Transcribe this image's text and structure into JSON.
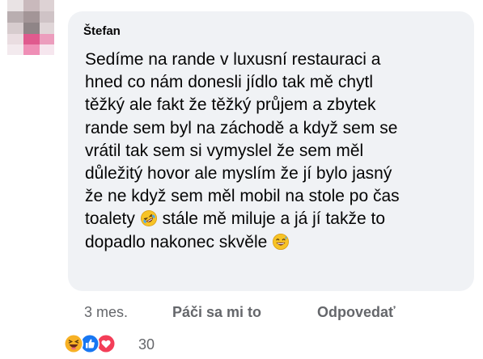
{
  "comment": {
    "author": "Štefan",
    "lines": [
      "Sedíme na rande v luxusní restauraci a",
      "hned co nám donesli jídlo tak mě chytl",
      "těžký ale fakt že těžký průjem a zbytek",
      "rande sem byl na záchodě a když sem se",
      "vrátil tak sem si vymyslel že sem měl",
      "důležitý hovor ale myslím že jí bylo jasný",
      "že ne když sem měl mobil na stole po čas"
    ],
    "line8_before": "toalety",
    "line8_after": "stále mě miluje a já jí takže to",
    "line9": "dopadlo nakonec skvěle",
    "emojis": [
      "rolling-on-floor-laughing-emoji",
      "grinning-sweat-emoji"
    ]
  },
  "meta": {
    "time": "3 mes.",
    "like_label": "Páči sa mi to",
    "reply_label": "Odpovedať"
  },
  "reactions": {
    "icons": [
      "haha-reaction-icon",
      "like-reaction-icon",
      "love-reaction-icon"
    ],
    "count": "30"
  },
  "colors": {
    "bubble": "#f0f2f5",
    "text": "#050505",
    "muted": "#65676b",
    "like_blue": "#1877f2",
    "love_red": "#f33e58",
    "haha_yellow": "#f7b125"
  }
}
